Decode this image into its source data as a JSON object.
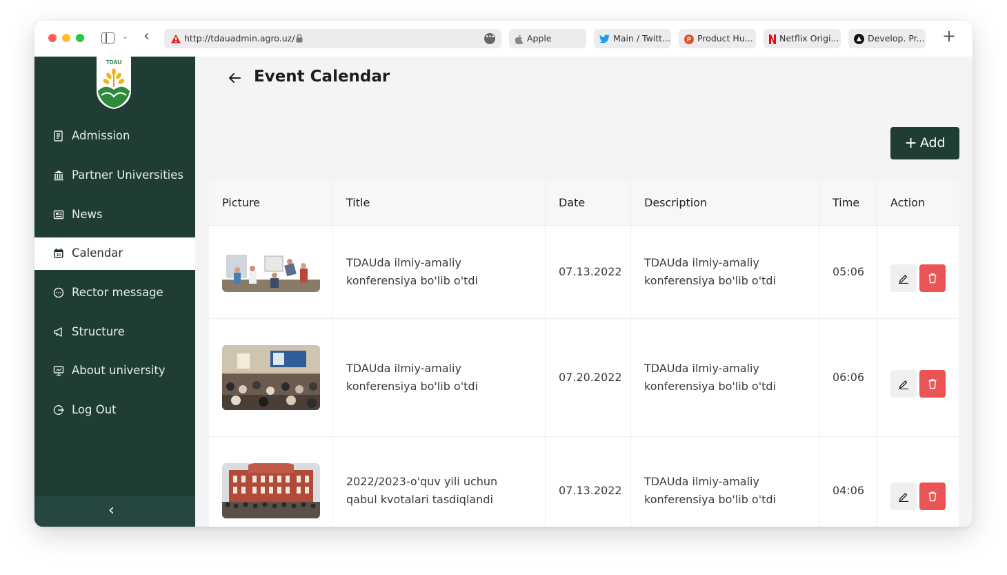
{
  "browser": {
    "url": "http://tdauadmin.agro.uz/",
    "bookmarks": [
      {
        "label": "Apple",
        "icon": "apple-icon"
      },
      {
        "label": "Main / Twitt...",
        "icon": "twitter-icon"
      },
      {
        "label": "Product Hu...",
        "icon": "product-hunt-icon"
      },
      {
        "label": "Netflix Origi...",
        "icon": "netflix-icon"
      },
      {
        "label": "Develop. Pr...",
        "icon": "develop-icon"
      }
    ]
  },
  "sidebar": {
    "logo_text": "TDAU",
    "items": [
      {
        "label": "Admission",
        "icon": "admission-icon",
        "active": false
      },
      {
        "label": "Partner Universities",
        "icon": "bank-icon",
        "active": false
      },
      {
        "label": "News",
        "icon": "news-icon",
        "active": false
      },
      {
        "label": "Calendar",
        "icon": "calendar-icon",
        "active": true
      },
      {
        "label": "Rector message",
        "icon": "message-icon",
        "active": false
      },
      {
        "label": "Structure",
        "icon": "megaphone-icon",
        "active": false
      },
      {
        "label": "About university",
        "icon": "presentation-icon",
        "active": false
      },
      {
        "label": "Log Out",
        "icon": "logout-icon",
        "active": false
      }
    ]
  },
  "page": {
    "title": "Event Calendar",
    "add_label": "Add"
  },
  "table": {
    "columns": [
      "Picture",
      "Title",
      "Date",
      "Description",
      "Time",
      "Action"
    ],
    "rows": [
      {
        "title": "TDAUda ilmiy-amaliy\nkonferensiya bo'lib o'tdi",
        "date": "07.13.2022",
        "description": "TDAUda ilmiy-amaliy\nkonferensiya bo'lib o'tdi",
        "time": "05:06"
      },
      {
        "title": "TDAUda ilmiy-amaliy\nkonferensiya bo'lib o'tdi",
        "date": "07.20.2022",
        "description": "TDAUda ilmiy-amaliy\nkonferensiya bo'lib o'tdi",
        "time": "06:06"
      },
      {
        "title": "2022/2023-o'quv yili uchun\nqabul kvotalari tasdiqlandi",
        "date": "07.13.2022",
        "description": "TDAUda ilmiy-amaliy\nkonferensiya bo'lib o'tdi",
        "time": "04:06"
      }
    ]
  },
  "colors": {
    "sidebar_bg": "#1f3d34",
    "delete": "#ea5455",
    "add_button": "#1f3d34"
  }
}
